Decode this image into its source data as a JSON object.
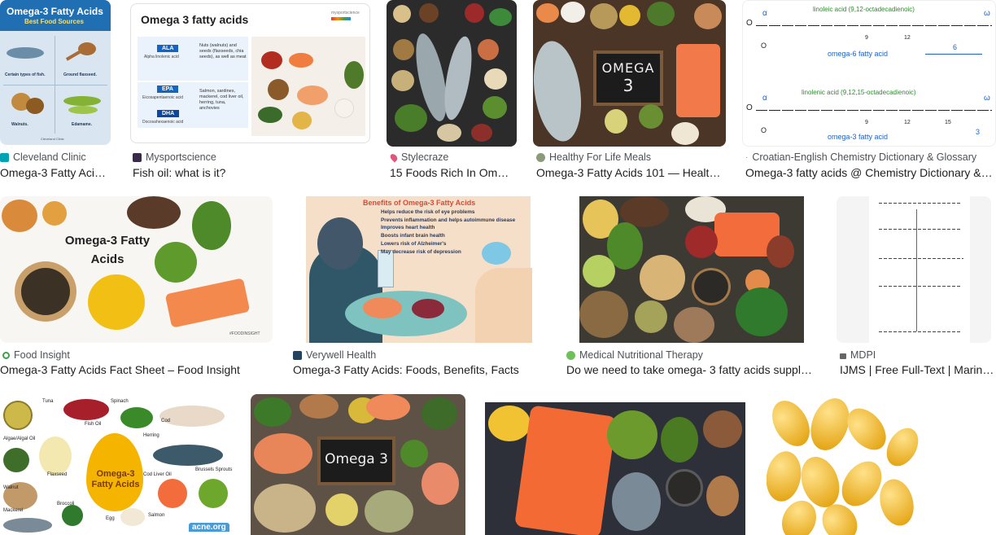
{
  "results": [
    {
      "source": "Cleveland Clinic",
      "title": "Omega-3 Fatty Acids: Types, Benefits & Food Sources",
      "thumb_heading": "Omega-3 Fatty Acids",
      "thumb_sub": "Best Food Sources",
      "thumb_labels": [
        "Certain types of fish.",
        "Ground flaxseed.",
        "Walnuts.",
        "Edamame."
      ],
      "thumb_logo": "Cleveland Clinic"
    },
    {
      "source": "Mysportscience",
      "title": "Fish oil: what is it?",
      "thumb_heading": "Omega 3 fatty acids",
      "thumb_brand": "mysportscience",
      "thumb_tags": [
        "ALA",
        "EPA",
        "DHA"
      ],
      "thumb_tag_sub": [
        "Alpha linolenic acid",
        "Eicosapentaenoic acid",
        "Docosahexaenoic acid"
      ],
      "thumb_desc": [
        "Nuts (walnuts) and seeds (flaxseeds, chia seeds), as well as meat",
        "Salmon, sardines, mackerel, cod liver oil, herring, tuna, anchovies"
      ]
    },
    {
      "source": "Stylecraze",
      "title": "15 Foods Rich In Omega-3 Fatty Acids"
    },
    {
      "source": "Healthy For Life Meals",
      "title": "Omega-3 Fatty Acids 101 — Healthy For Life Meals",
      "thumb_board": [
        "OMEGA",
        "3"
      ]
    },
    {
      "source": "Croatian-English Chemistry Dictionary & Glossary",
      "title": "Omega-3 fatty acids @ Chemistry Dictionary & Glossary",
      "thumb_top": "linoleic acid (9,12-octadecadienoic)",
      "thumb_top_label": "omega-6 fatty acid",
      "thumb_bottom": "linolenic acid (9,12,15-octadecadienoic)",
      "thumb_bottom_label": "omega-3 fatty acid",
      "greek_alpha": "α",
      "greek_omega": "ω",
      "nums_top": [
        "9",
        "12",
        "6"
      ],
      "nums_bottom": [
        "9",
        "12",
        "15",
        "3"
      ]
    },
    {
      "source": "Food Insight",
      "title": "Omega-3 Fatty Acids Fact Sheet – Food Insight",
      "thumb_heading": "Omega-3 Fatty Acids",
      "thumb_tag": "#FOODINSIGHT"
    },
    {
      "source": "Verywell Health",
      "title": "Omega-3 Fatty Acids: Foods, Benefits, Facts",
      "thumb_heading": "Benefits of Omega-3 Fatty Acids",
      "thumb_bullets": [
        "Helps reduce the risk of eye problems",
        "Prevents inflammation and helps autoimmune disease",
        "Improves heart health",
        "Boosts infant brain health",
        "Lowers risk of Alzheimer's",
        "May decrease risk of depression"
      ]
    },
    {
      "source": "Medical Nutritional Therapy",
      "title": "Do we need to take omega- 3 fatty acids supplements?"
    },
    {
      "source": "MDPI",
      "title": "IJMS | Free Full-Text | Marine Omega-3 Fatty Acids"
    },
    {
      "source": "",
      "title": "",
      "thumb_center": "Omega-3 Fatty Acids",
      "thumb_items": [
        "Tuna",
        "Spinach",
        "Fish Oil",
        "Cod",
        "Algae/Algal Oil",
        "Herring",
        "Flaxseed",
        "Brussels Sprouts",
        "Walnut",
        "Cod Liver Oil",
        "Mackerel",
        "Broccoli",
        "Egg",
        "Salmon"
      ],
      "thumb_logo": "acne.org"
    },
    {
      "source": "",
      "title": "",
      "thumb_board": "Omega 3"
    },
    {
      "source": "",
      "title": ""
    },
    {
      "source": "",
      "title": ""
    }
  ]
}
